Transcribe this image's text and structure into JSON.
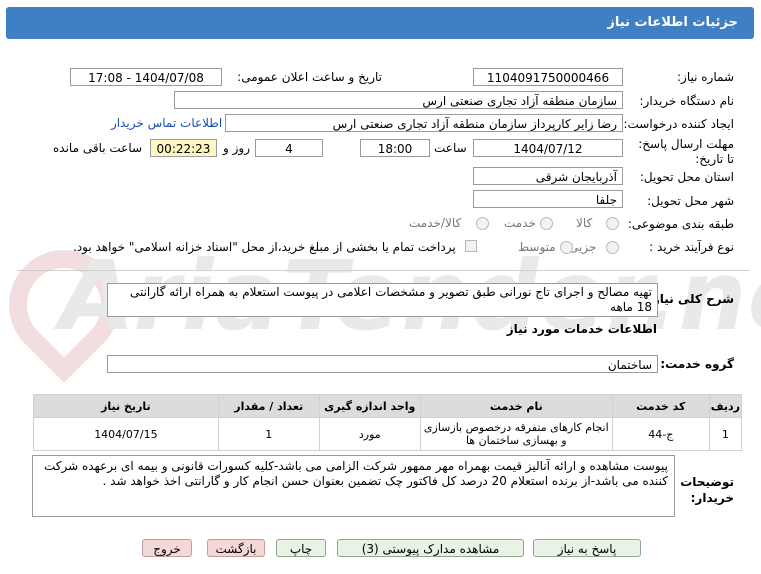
{
  "header": {
    "title": "جزئیات اطلاعات نیاز"
  },
  "watermark": {
    "text": "AriaTender.net"
  },
  "labels": {
    "need_number": "شماره نیاز:",
    "announce_datetime": "تاریخ و ساعت اعلان عمومی:",
    "buyer_org": "نام دستگاه خریدار:",
    "requester": "ایجاد کننده درخواست:",
    "deadline": "مهلت ارسال پاسخ: تا تاریخ:",
    "time": "ساعت",
    "day_and": "روز و",
    "remaining": "ساعت باقی مانده",
    "province": "استان محل تحویل:",
    "city": "شهر محل تحویل:",
    "category": "طبقه بندی موضوعی:",
    "process_type": "نوع فرآیند خرید :",
    "description": "شرح کلی نیاز:",
    "services_info": "اطلاعات خدمات مورد نیاز",
    "service_group": "گروه خدمت:",
    "buyer_notes": "توضیحات خریدار:"
  },
  "fields": {
    "need_number": "1104091750000466",
    "announce_datetime": "1404/07/08 - 17:08",
    "buyer_org": "سازمان منطقه آزاد تجاری صنعتی ارس",
    "requester": "رضا زایر کارپرداز سازمان منطقه آزاد تجاری صنعتی ارس",
    "contact_link": "اطلاعات تماس خریدار",
    "deadline_date": "1404/07/12",
    "deadline_time": "18:00",
    "days": "4",
    "remaining_time": "00:22:23",
    "province": "آذربایجان شرقی",
    "city": "جلفا",
    "description": "تهیه مصالح و اجرای تاج نورانی طبق تصویر و مشخصات اعلامی در پیوست استعلام به همراه ارائه گارانتی 18 ماهه",
    "service_group": "ساختمان",
    "buyer_notes": "پیوست مشاهده و ارائه آنالیز قیمت بهمراه مهر ممهور شرکت الزامی می باشد-کلیه کسورات قانونی و بیمه ای برعهده شرکت کننده می باشد-از برنده استعلام 20 درصد کل فاکتور چک تضمین بعنوان حسن انجام کار و گارانتی اخذ خواهد شد ."
  },
  "category_options": [
    "کالا",
    "خدمت",
    "کالا/خدمت"
  ],
  "process_options": [
    "جزیی",
    "متوسط"
  ],
  "payment_note": "پرداخت تمام یا بخشی از مبلغ خرید،از محل \"اسناد خزانه اسلامی\" خواهد بود.",
  "table": {
    "headers": [
      "ردیف",
      "کد خدمت",
      "نام خدمت",
      "واحد اندازه گیری",
      "تعداد / مقدار",
      "تاریخ نیاز"
    ],
    "rows": [
      [
        "1",
        "ج-44",
        "انجام کارهای متفرقه درخصوص بازسازی و بهسازی ساختمان ها",
        "مورد",
        "1",
        "1404/07/15"
      ]
    ]
  },
  "buttons": {
    "reply": "پاسخ به نیاز",
    "view_docs": "مشاهده مدارک پیوستی (3)",
    "print": "چاپ",
    "back": "بازگشت",
    "exit": "خروج"
  }
}
